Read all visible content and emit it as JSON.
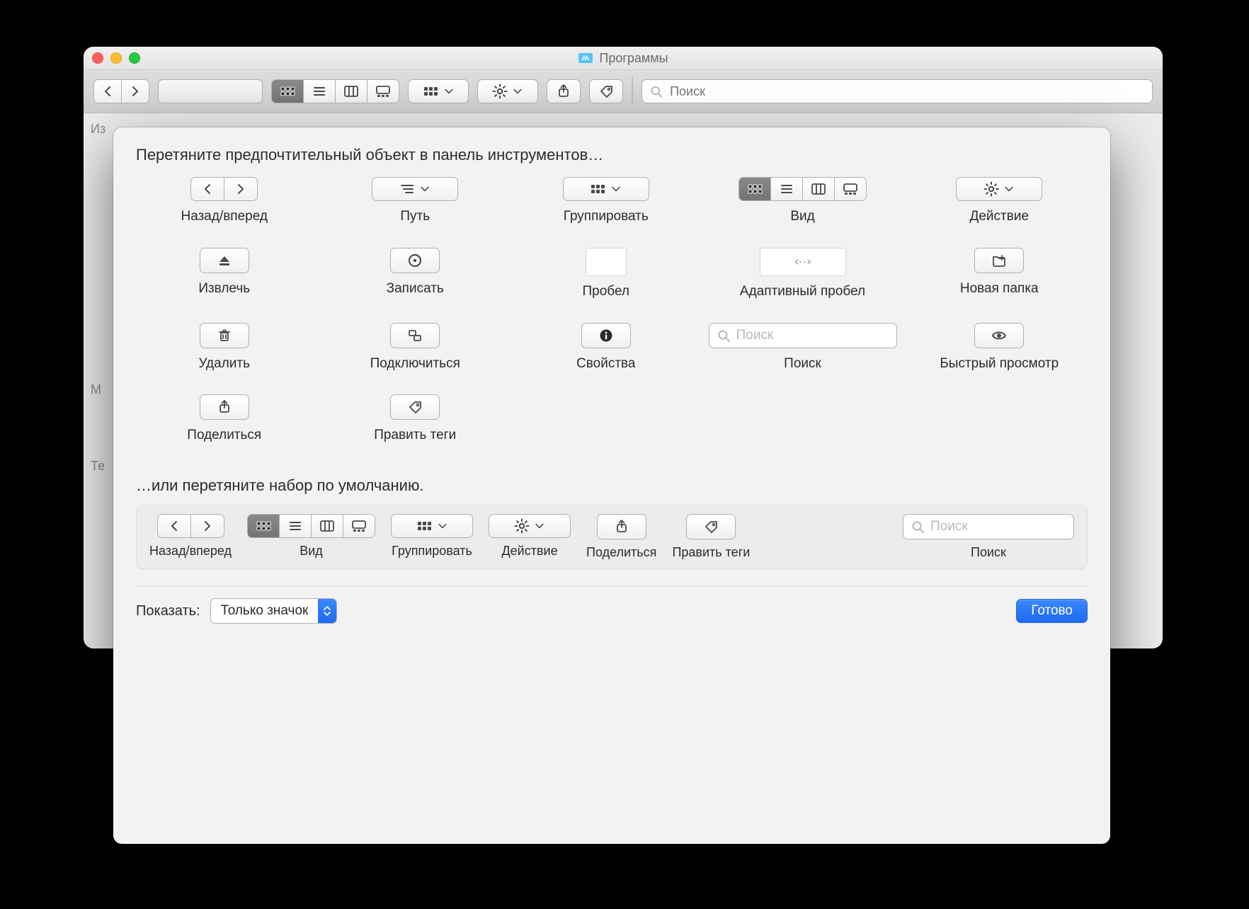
{
  "window": {
    "title": "Программы",
    "search_placeholder": "Поиск"
  },
  "sidebar_hints": [
    "Из",
    "М",
    "Те"
  ],
  "sheet": {
    "drag_instruction": "Перетяните предпочтительный объект в панель инструментов…",
    "default_instruction": "…или перетяните набор по умолчанию.",
    "show_label": "Показать:",
    "show_value": "Только значок",
    "done": "Готово"
  },
  "palette": {
    "back_forward": "Назад/вперед",
    "path": "Путь",
    "group": "Группировать",
    "view": "Вид",
    "action": "Действие",
    "eject": "Извлечь",
    "burn": "Записать",
    "space": "Пробел",
    "flex_space": "Адаптивный пробел",
    "new_folder": "Новая папка",
    "delete": "Удалить",
    "connect": "Подключиться",
    "info": "Свойства",
    "search": "Поиск",
    "quicklook": "Быстрый просмотр",
    "share": "Поделиться",
    "tags": "Править теги",
    "search_placeholder": "Поиск"
  },
  "default_set": {
    "back_forward": "Назад/вперед",
    "view": "Вид",
    "group": "Группировать",
    "action": "Действие",
    "share": "Поделиться",
    "tags": "Править теги",
    "search": "Поиск",
    "search_placeholder": "Поиск"
  }
}
